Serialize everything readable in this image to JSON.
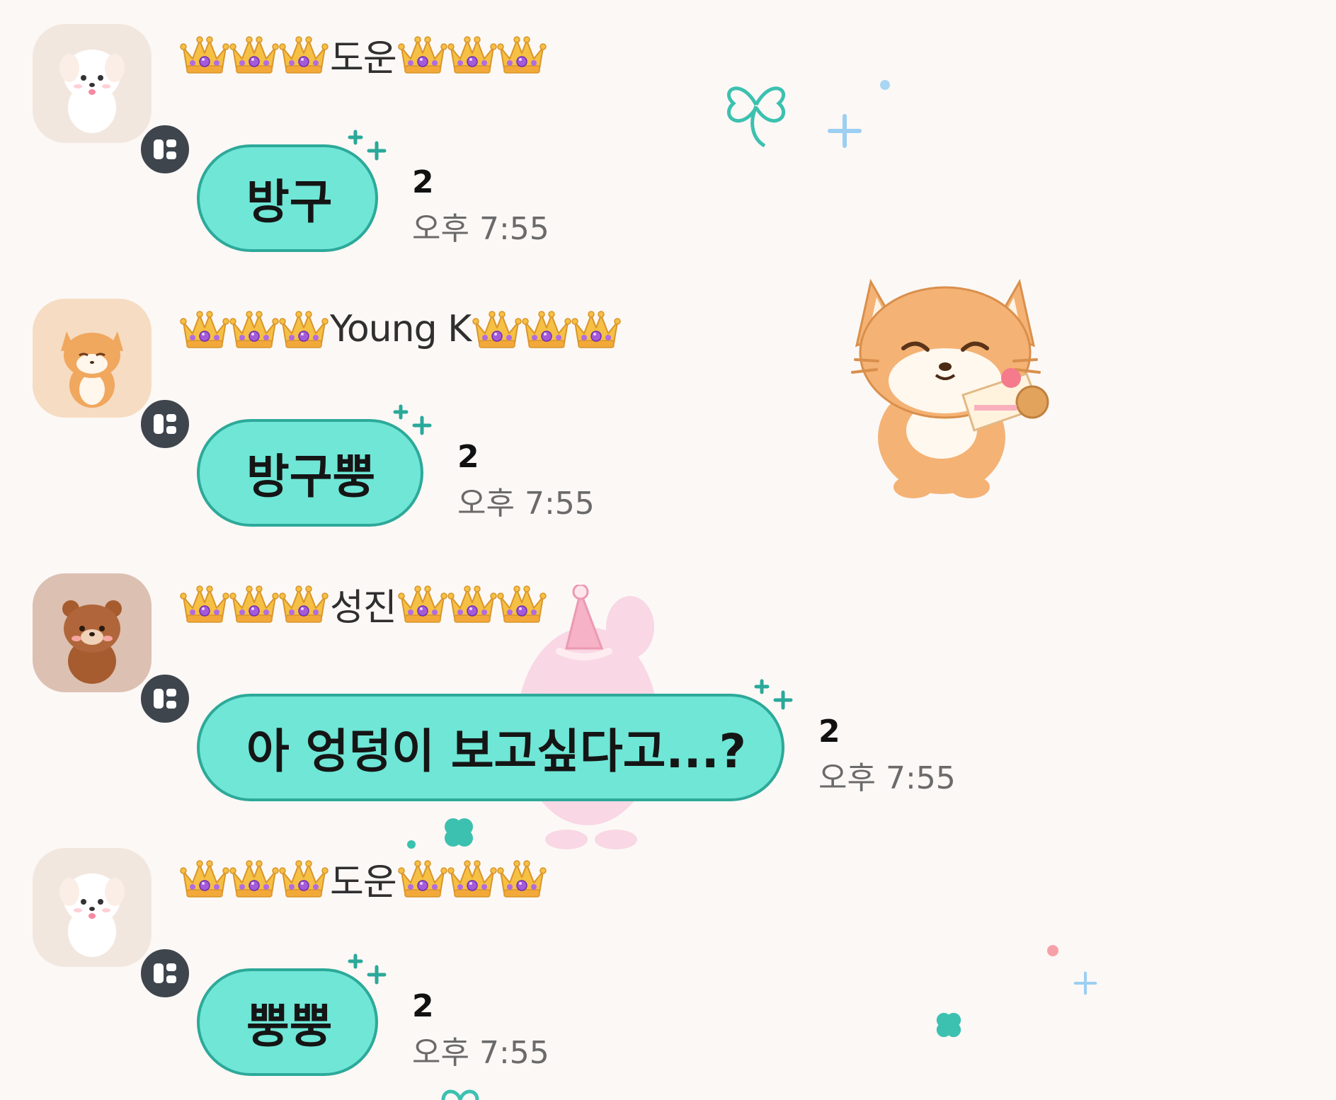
{
  "messages": [
    {
      "sender": "도운",
      "avatar_icon": "white-puppy-avatar-icon",
      "text": "방구",
      "unread": "2",
      "time": "오후 7:55"
    },
    {
      "sender": "Young K",
      "avatar_icon": "fox-avatar-icon",
      "text": "방구뿡",
      "unread": "2",
      "time": "오후 7:55"
    },
    {
      "sender": "성진",
      "avatar_icon": "brown-bear-avatar-icon",
      "text": "아 엉덩이 보고싶다고...?",
      "unread": "2",
      "time": "오후 7:55"
    },
    {
      "sender": "도운",
      "avatar_icon": "white-puppy-avatar-icon",
      "text": "뿡뿡",
      "unread": "2",
      "time": "오후 7:55"
    }
  ],
  "theme": {
    "background": "#fcf8f6",
    "bubble_fill": "#6fe6d6",
    "bubble_border": "#2da999",
    "badge": "#3f454d",
    "crown_gold": "#f2b73a",
    "crown_gem": "#9b5ad6"
  },
  "decorations": [
    "clover-icon",
    "fox-with-cake-sticker",
    "pink-bunny-party-hat-sticker",
    "sparkle-icon"
  ]
}
